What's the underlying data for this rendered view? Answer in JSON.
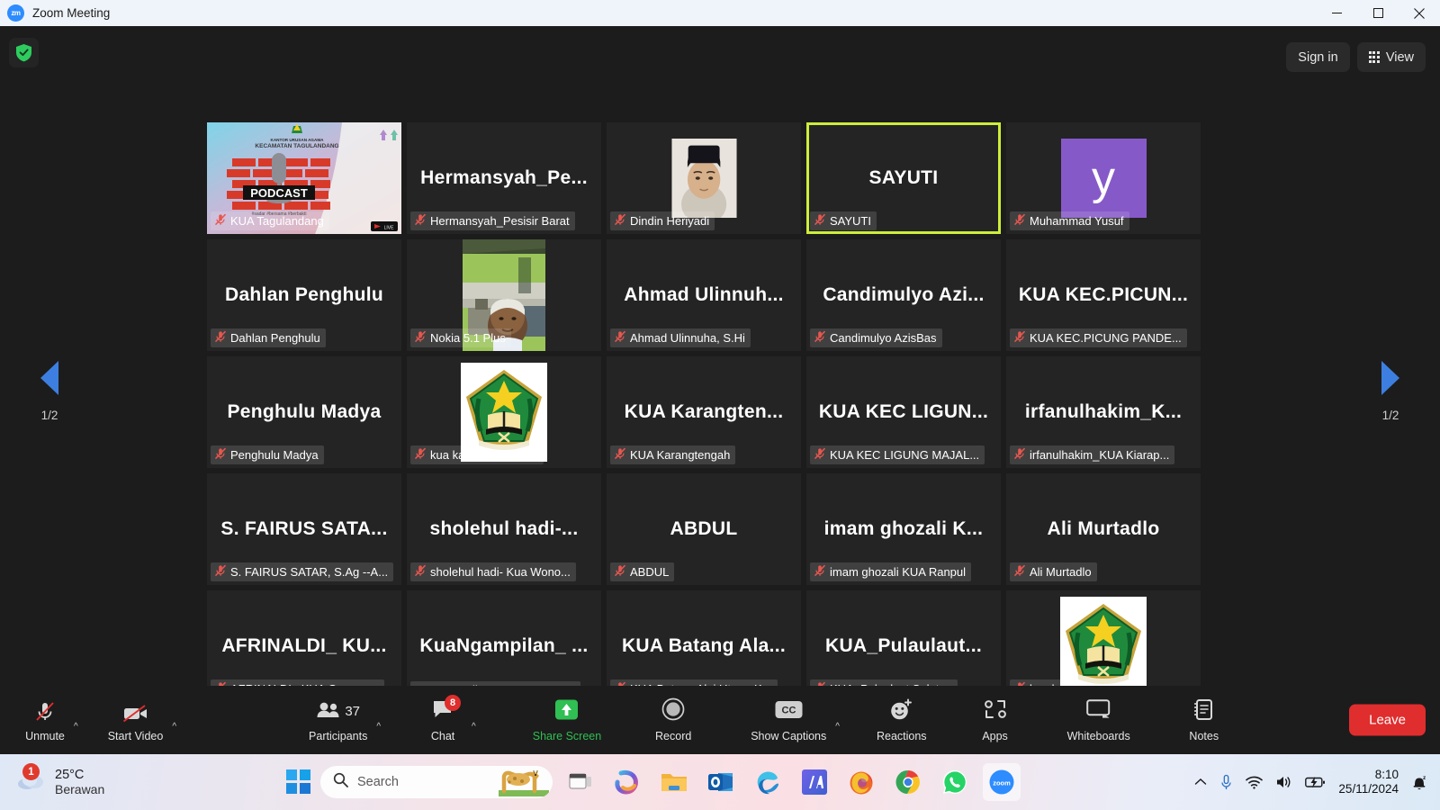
{
  "window": {
    "title": "Zoom Meeting",
    "logo_text": "zm",
    "minimize_icon": "minimize-icon",
    "maximize_icon": "maximize-icon",
    "close_icon": "close-icon"
  },
  "topbar": {
    "shield_icon": "encryption-shield-icon",
    "sign_in_label": "Sign in",
    "view_label": "View",
    "view_icon": "grid-view-icon"
  },
  "gallery": {
    "page_left": "1/2",
    "page_right": "1/2",
    "prev_icon": "previous-page-arrow-icon",
    "next_icon": "next-page-arrow-icon",
    "participants": [
      {
        "label": "KUA Tagulandang",
        "display": "",
        "muted": true,
        "kind": "video-podcast",
        "active": false
      },
      {
        "label": "Hermansyah_Pesisir Barat",
        "display": "Hermansyah_Pe...",
        "muted": true,
        "kind": "name",
        "active": false
      },
      {
        "label": "Dindin Heriyadi",
        "display": "",
        "muted": true,
        "kind": "photo",
        "active": false
      },
      {
        "label": "SAYUTI",
        "display": "SAYUTI",
        "muted": true,
        "kind": "name",
        "active": true
      },
      {
        "label": "Muhammad Yusuf",
        "display": "y",
        "muted": true,
        "kind": "avatar-y",
        "active": false
      },
      {
        "label": "Dahlan Penghulu",
        "display": "Dahlan Penghulu",
        "muted": true,
        "kind": "name",
        "active": false
      },
      {
        "label": "Nokia 5.1 Plus",
        "display": "",
        "muted": true,
        "kind": "video-room",
        "active": false
      },
      {
        "label": "Ahmad Ulinnuha, S.Hi",
        "display": "Ahmad Ulinnuh...",
        "muted": true,
        "kind": "name",
        "active": false
      },
      {
        "label": "Candimulyo AzisBas",
        "display": "Candimulyo Azi...",
        "muted": true,
        "kind": "name",
        "active": false
      },
      {
        "label": "KUA KEC.PICUNG PANDE...",
        "display": "KUA  KEC.PICUN...",
        "muted": true,
        "kind": "name",
        "active": false
      },
      {
        "label": "Penghulu Madya",
        "display": "Penghulu Madya",
        "muted": true,
        "kind": "name",
        "active": false
      },
      {
        "label": "kua karya penggawa",
        "display": "",
        "muted": true,
        "kind": "logo-kemenag",
        "active": false
      },
      {
        "label": "KUA Karangtengah",
        "display": "KUA  Karangten...",
        "muted": true,
        "kind": "name",
        "active": false
      },
      {
        "label": "KUA KEC LIGUNG MAJAL...",
        "display": "KUA KEC LIGUN...",
        "muted": true,
        "kind": "name",
        "active": false
      },
      {
        "label": "irfanulhakim_KUA Kiarap...",
        "display": "irfanulhakim_K...",
        "muted": true,
        "kind": "name",
        "active": false
      },
      {
        "label": "S. FAIRUS SATAR, S.Ag --A...",
        "display": "S. FAIRUS SATA...",
        "muted": true,
        "kind": "name",
        "active": false
      },
      {
        "label": "sholehul hadi- Kua Wono...",
        "display": "sholehul hadi-...",
        "muted": true,
        "kind": "name",
        "active": false
      },
      {
        "label": "ABDUL",
        "display": "ABDUL",
        "muted": true,
        "kind": "name",
        "active": false
      },
      {
        "label": "imam ghozali KUA Ranpul",
        "display": "imam ghozali K...",
        "muted": true,
        "kind": "name",
        "active": false
      },
      {
        "label": "Ali Murtadlo",
        "display": "Ali Murtadlo",
        "muted": true,
        "kind": "name",
        "active": false
      },
      {
        "label": "AFRINALDI_ KUA Gunung...",
        "display": "AFRINALDI_ KU...",
        "muted": true,
        "kind": "name",
        "active": false
      },
      {
        "label": "KuaNgampilan_Yogya_Fauzan",
        "display": "KuaNgampilan_ ...",
        "muted": false,
        "kind": "name",
        "active": false
      },
      {
        "label": "KUA Batang Alai Utara_K...",
        "display": "KUA Batang Ala...",
        "muted": true,
        "kind": "name",
        "active": false
      },
      {
        "label": "KUA_Pulaulaut Selatan",
        "display": "KUA_Pulaulaut...",
        "muted": true,
        "kind": "name",
        "active": false
      },
      {
        "label": "kua las",
        "display": "",
        "muted": true,
        "kind": "logo-kemenag",
        "active": false
      }
    ]
  },
  "toolbar": {
    "items": [
      {
        "label": "Unmute",
        "icon": "microphone-muted-icon",
        "caret": true
      },
      {
        "label": "Start Video",
        "icon": "camera-off-icon",
        "caret": true
      },
      {
        "label": "Participants",
        "icon": "participants-icon",
        "count": "37",
        "caret": true
      },
      {
        "label": "Chat",
        "icon": "chat-icon",
        "badge": "8",
        "caret": true
      },
      {
        "label": "Share Screen",
        "icon": "share-screen-icon",
        "caret": false,
        "green": true
      },
      {
        "label": "Record",
        "icon": "record-icon",
        "caret": false
      },
      {
        "label": "Show Captions",
        "icon": "closed-captions-icon",
        "caret": true
      },
      {
        "label": "Reactions",
        "icon": "reactions-icon",
        "caret": false
      },
      {
        "label": "Apps",
        "icon": "apps-icon",
        "caret": false
      },
      {
        "label": "Whiteboards",
        "icon": "whiteboard-icon",
        "caret": false
      },
      {
        "label": "Notes",
        "icon": "notes-icon",
        "caret": false
      }
    ],
    "leave_label": "Leave"
  },
  "taskbar": {
    "weather": {
      "temperature": "25°C",
      "condition": "Berawan",
      "badge": "1",
      "icon": "cloud-icon"
    },
    "start_icon": "windows-start-icon",
    "search": {
      "placeholder": "Search",
      "icon": "search-icon",
      "decoration": "giraffe-icon"
    },
    "apps": [
      {
        "name": "task-view-icon"
      },
      {
        "name": "copilot-icon"
      },
      {
        "name": "file-explorer-icon"
      },
      {
        "name": "outlook-icon"
      },
      {
        "name": "microsoft-edge-icon"
      },
      {
        "name": "ia-app-icon"
      },
      {
        "name": "firefox-icon"
      },
      {
        "name": "google-chrome-icon"
      },
      {
        "name": "whatsapp-icon"
      },
      {
        "name": "zoom-icon"
      }
    ],
    "tray": {
      "overflow_icon": "show-hidden-icons-chevron",
      "mic_icon": "microphone-icon",
      "wifi_icon": "wifi-icon",
      "volume_icon": "speaker-icon",
      "battery_icon": "battery-charging-icon",
      "notification_icon": "notifications-silent-icon"
    },
    "clock": {
      "time": "8:10",
      "date": "25/11/2024"
    }
  },
  "colors": {
    "accent_active": "#cdee3a",
    "leave_red": "#e02d2d",
    "share_green": "#2fbf53",
    "zoom_blue": "#2d8cff"
  }
}
